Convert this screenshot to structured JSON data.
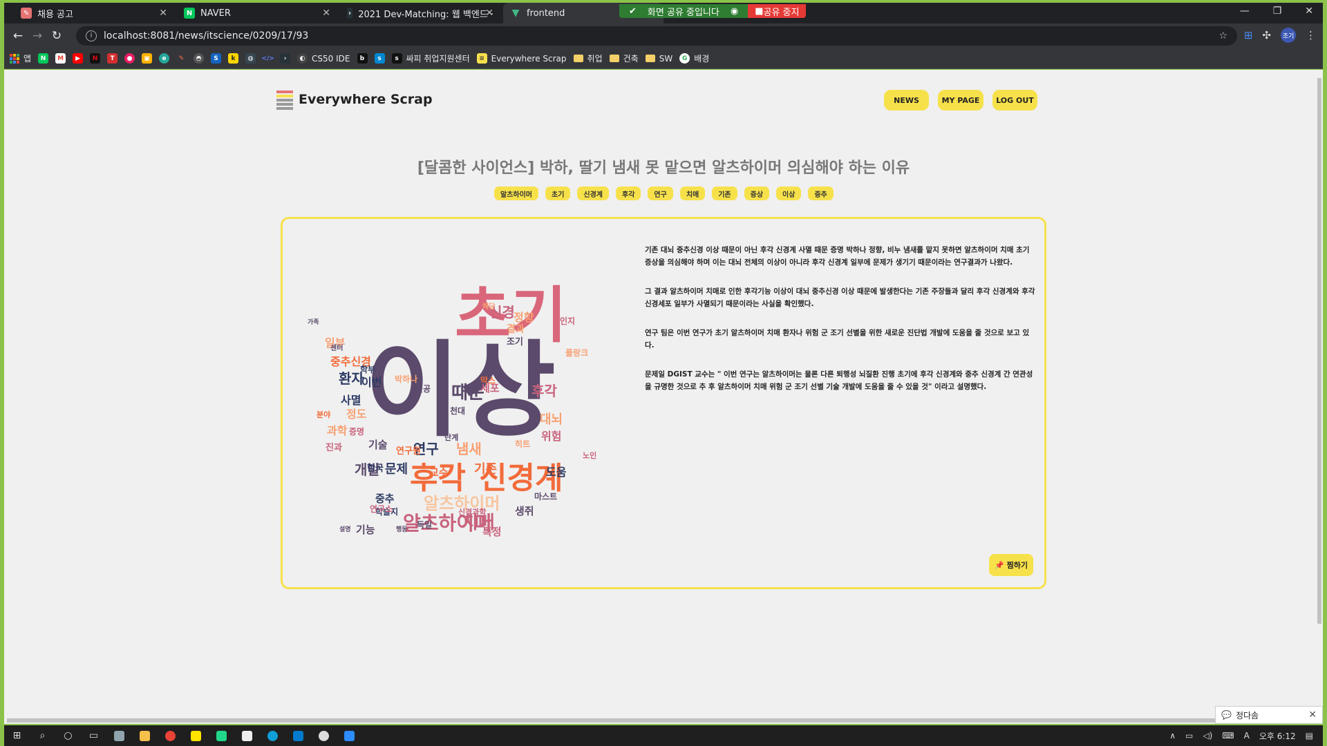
{
  "browser": {
    "tabs": [
      {
        "label": "채용 공고",
        "icon": "pencil-icon",
        "color": "#e57373"
      },
      {
        "label": "NAVER",
        "icon": "naver-icon",
        "color": "#03c75a"
      },
      {
        "label": "2021 Dev-Matching: 웹 백엔드 ·",
        "icon": "programmers-icon",
        "color": "#263238"
      },
      {
        "label": "frontend",
        "icon": "vue-icon",
        "color": "#41b883"
      }
    ],
    "share_notice": "화면 공유 중입니다",
    "stop_share": "공유 중지",
    "url": "localhost:8081/news/itscience/0209/17/93",
    "bookmarks": [
      {
        "label": "앱",
        "color": "#ea4335"
      },
      {
        "label": "",
        "color": "#03c75a"
      },
      {
        "label": "",
        "color": "#ea4335"
      },
      {
        "label": "",
        "color": "#ff0000"
      },
      {
        "label": "",
        "color": "#e50914"
      },
      {
        "label": "",
        "color": "#d32f2f"
      },
      {
        "label": "",
        "color": "#e91e63"
      },
      {
        "label": "",
        "color": "#ffb300"
      },
      {
        "label": "",
        "color": "#26a69a"
      },
      {
        "label": "",
        "color": "#ff7043"
      },
      {
        "label": "",
        "color": "#555555"
      },
      {
        "label": "",
        "color": "#1565c0"
      },
      {
        "label": "",
        "color": "#ffd600"
      },
      {
        "label": "",
        "color": "#37474f"
      },
      {
        "label": "",
        "color": "#3949ab"
      },
      {
        "label": "",
        "color": "#263238"
      },
      {
        "label": "CS50 IDE",
        "color": "#444444"
      },
      {
        "label": "",
        "color": "#111111"
      },
      {
        "label": "",
        "color": "#0288d1"
      },
      {
        "label": "싸피 취업지원센터",
        "color": "#111111"
      },
      {
        "label": "Everywhere Scrap",
        "color": "#f7e14b"
      }
    ],
    "bookmark_folders": [
      "취업",
      "건축",
      "SW"
    ],
    "bookmark_last": "배경"
  },
  "site": {
    "logo": "Everywhere Scrap",
    "nav": [
      "NEWS",
      "MY PAGE",
      "LOG OUT"
    ]
  },
  "article": {
    "title": "[달콤한 사이언스] 박하, 딸기 냄새 못 맡으면 알츠하이머 의심해야 하는 이유",
    "tags": [
      "알츠하이머",
      "초기",
      "신경계",
      "후각",
      "연구",
      "치매",
      "기존",
      "증상",
      "이상",
      "중추"
    ],
    "paragraphs": [
      "기존 대뇌 중추신경 이상 때문이 아닌 후각 신경계 사멸 때문 증명 박하나 정향, 비누 냄새를 맡지 못하면 알츠하이머 치매 초기 증상을 의심해야 하며 이는 대뇌 전체의 이상이 아니라 후각 신경계 일부에 문제가 생기기 때문이라는 연구결과가 나왔다.",
      "그 결과 알츠하이머 치매로 인한 후각기능 이상이 대뇌 중추신경 이상 때문에 발생한다는 기존 주장들과 달리 후각 신경계와 후각신경세포 일부가 사멸되기 때문이라는 사실을 확인했다.",
      "연구 팀은 이번 연구가 초기 알츠하이머 치매 환자나 위험 군 조기 선별을 위한 새로운 진단법 개발에 도움을 줄 것으로 보고 있다.",
      "문제일 DGIST 교수는 \" 이번 연구는 알츠하이머는 물론 다른 퇴행성 뇌질환 진행 초기에 후각 신경계와 중추 신경계 간 연관성을 규명한 것으로 추 후 알츠하이머 치매 위험 군 조기 선별 기술 개발에 도움을 줄 수 있을 것\" 이라고 설명했다."
    ],
    "pin_label": "📌 찜하기"
  },
  "wordcloud": {
    "words": [
      {
        "text": "이상",
        "c": "#5b4a6b"
      },
      {
        "text": "초기",
        "c": "#d9667a"
      },
      {
        "text": "후각",
        "c": "#f26b3a"
      },
      {
        "text": "신경계",
        "c": "#f26b3a"
      },
      {
        "text": "알츠하이머",
        "c": "#c9627c"
      },
      {
        "text": "치매",
        "c": "#c9627c"
      },
      {
        "text": "알츠하이머",
        "c": "#f7c59f"
      },
      {
        "text": "때문",
        "c": "#5b4a6b"
      },
      {
        "text": "냄새",
        "c": "#f7a072"
      },
      {
        "text": "연구",
        "c": "#2d3a63"
      },
      {
        "text": "기존",
        "c": "#f26b3a"
      },
      {
        "text": "문제",
        "c": "#2d3a63"
      },
      {
        "text": "개발",
        "c": "#5b4a6b"
      },
      {
        "text": "신경",
        "c": "#c9627c"
      },
      {
        "text": "정향",
        "c": "#f7a072"
      },
      {
        "text": "중추신경",
        "c": "#f26b3a"
      },
      {
        "text": "환자",
        "c": "#2d3a63"
      },
      {
        "text": "이번",
        "c": "#2d3a63"
      },
      {
        "text": "사멸",
        "c": "#2d3a63"
      },
      {
        "text": "일부",
        "c": "#f7a072"
      },
      {
        "text": "정도",
        "c": "#f7a072"
      },
      {
        "text": "과학",
        "c": "#f7a072"
      },
      {
        "text": "기술",
        "c": "#5b4a6b"
      },
      {
        "text": "대뇌",
        "c": "#f7a072"
      },
      {
        "text": "후각",
        "c": "#c9627c"
      },
      {
        "text": "위험",
        "c": "#c9627c"
      },
      {
        "text": "도움",
        "c": "#2d3a63"
      },
      {
        "text": "중추",
        "c": "#2d3a63"
      },
      {
        "text": "교수",
        "c": "#f26b3a"
      },
      {
        "text": "연구원",
        "c": "#f26b3a"
      },
      {
        "text": "특정",
        "c": "#c9627c"
      },
      {
        "text": "기능",
        "c": "#5b4a6b"
      },
      {
        "text": "세포",
        "c": "#c9627c"
      },
      {
        "text": "천대",
        "c": "#5b4a6b"
      },
      {
        "text": "조기",
        "c": "#5b4a6b"
      },
      {
        "text": "플랑크",
        "c": "#f7a072"
      },
      {
        "text": "인지",
        "c": "#c9627c"
      },
      {
        "text": "생쥐",
        "c": "#5b4a6b"
      },
      {
        "text": "한국",
        "c": "#2d3a63"
      },
      {
        "text": "진과",
        "c": "#c9627c"
      },
      {
        "text": "증명",
        "c": "#c9627c"
      },
      {
        "text": "학술지",
        "c": "#2d3a63"
      },
      {
        "text": "마스트",
        "c": "#5b4a6b"
      },
      {
        "text": "가족",
        "c": "#5b4a6b"
      },
      {
        "text": "센터",
        "c": "#5b4a6b"
      },
      {
        "text": "학부",
        "c": "#2d3a63"
      },
      {
        "text": "박하나",
        "c": "#f7a072"
      },
      {
        "text": "전공",
        "c": "#5b4a6b"
      },
      {
        "text": "막스",
        "c": "#f26b3a"
      },
      {
        "text": "히트",
        "c": "#f7a072"
      },
      {
        "text": "연구소",
        "c": "#c9627c"
      },
      {
        "text": "독일",
        "c": "#5b4a6b"
      },
      {
        "text": "분야",
        "c": "#f26b3a"
      },
      {
        "text": "단계",
        "c": "#5b4a6b"
      },
      {
        "text": "노인",
        "c": "#c9627c"
      },
      {
        "text": "해당",
        "c": "#f7a072"
      },
      {
        "text": "결과",
        "c": "#f7a072"
      },
      {
        "text": "신경과학",
        "c": "#c9627c"
      },
      {
        "text": "행동",
        "c": "#5b4a6b"
      },
      {
        "text": "설명",
        "c": "#5b4a6b"
      }
    ]
  },
  "taskbar": {
    "time": "오후 6:12",
    "chat_user": "정다솜",
    "ime": "A"
  }
}
